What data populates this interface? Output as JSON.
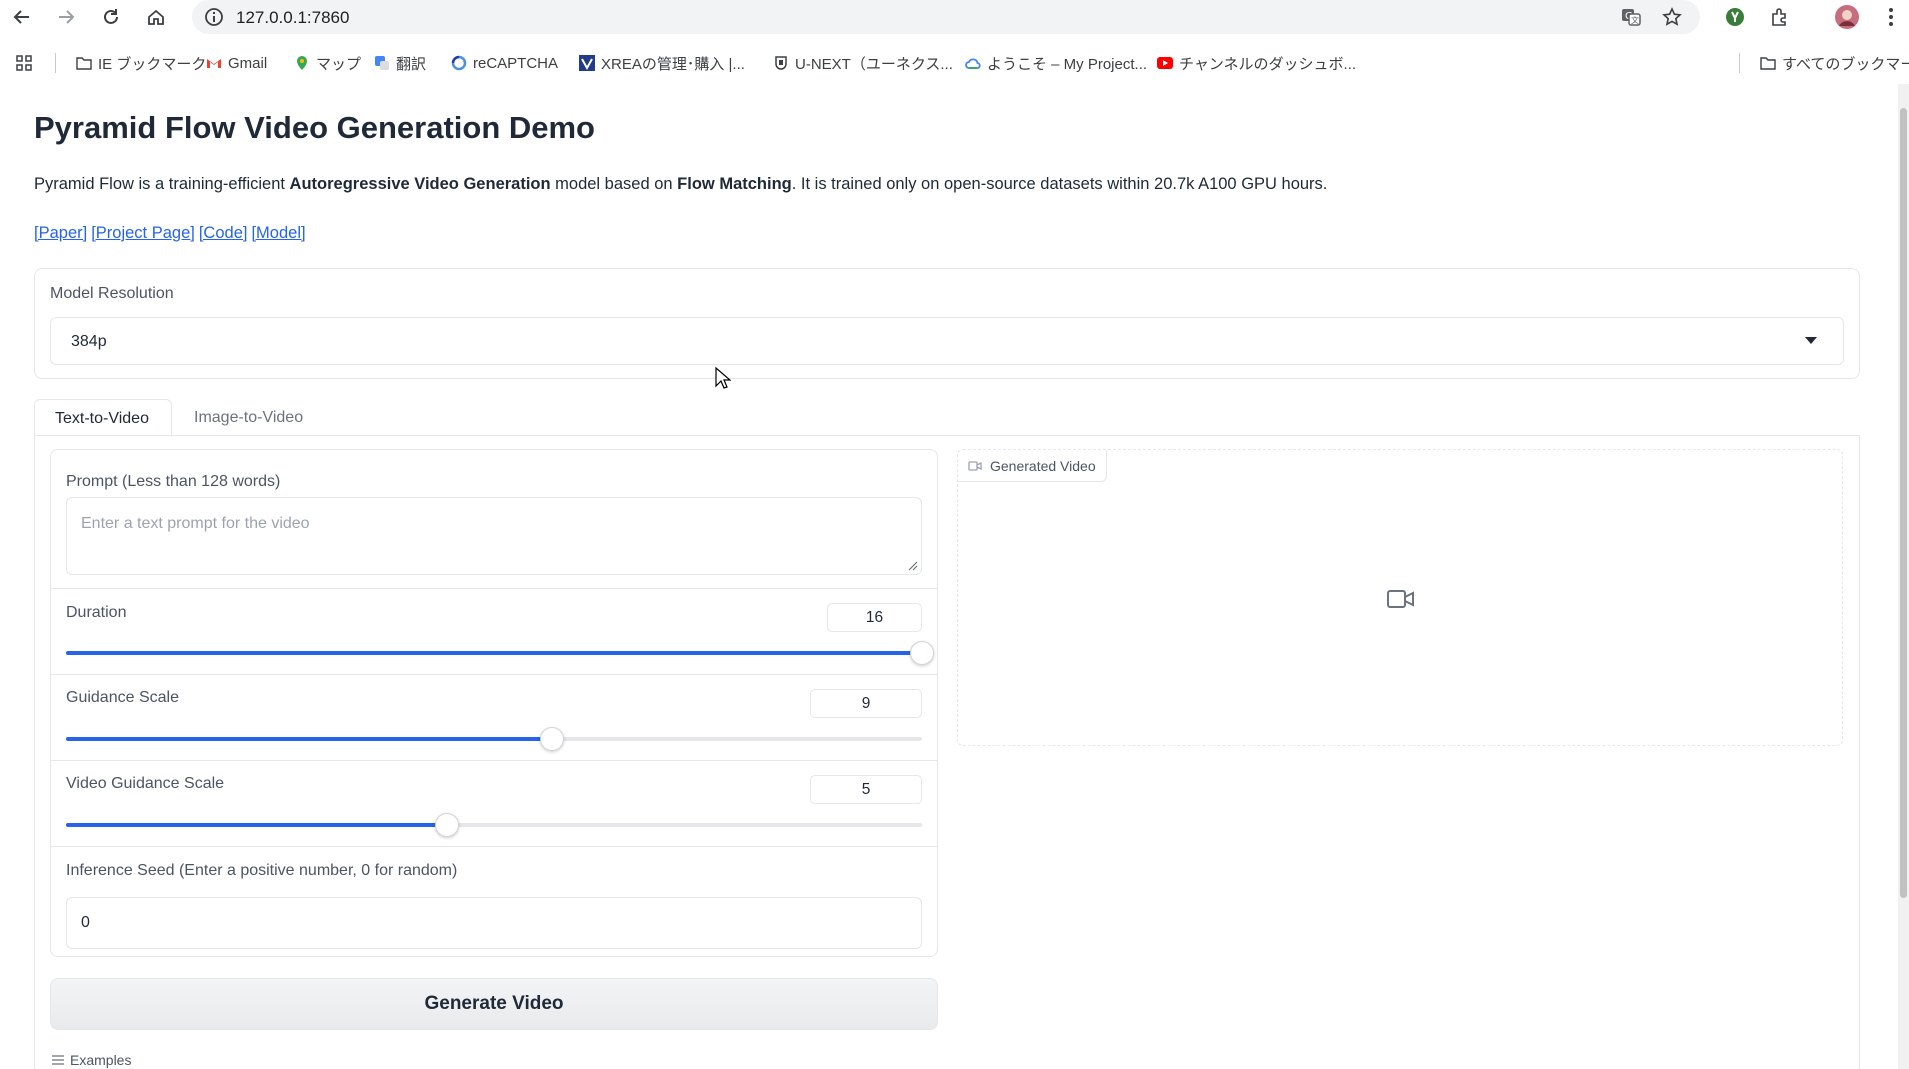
{
  "browser": {
    "url": "127.0.0.1:7860",
    "bookmarks": [
      {
        "label": "IE ブックマーク",
        "icon": "folder-icon"
      },
      {
        "label": "Gmail",
        "icon": "gmail-icon"
      },
      {
        "label": "マップ",
        "icon": "maps-icon"
      },
      {
        "label": "翻訳",
        "icon": "translate-icon"
      },
      {
        "label": "reCAPTCHA",
        "icon": "recaptcha-icon"
      },
      {
        "label": "XREAの管理･購入 |...",
        "icon": "xrea-icon"
      },
      {
        "label": "U-NEXT（ユーネクス...",
        "icon": "unext-icon"
      },
      {
        "label": "ようこそ – My Project...",
        "icon": "cloud-icon"
      },
      {
        "label": "チャンネルのダッシュボ...",
        "icon": "youtube-icon"
      }
    ],
    "all_bookmarks": "すべてのブックマーク"
  },
  "page": {
    "title": "Pyramid Flow Video Generation Demo",
    "description": {
      "part1": "Pyramid Flow is a training-efficient ",
      "bold1": "Autoregressive Video Generation",
      "part2": " model based on ",
      "bold2": "Flow Matching",
      "part3": ". It is trained only on open-source datasets within 20.7k A100 GPU hours."
    },
    "links": [
      "[Paper]",
      "[Project Page]",
      "[Code]",
      "[Model]"
    ]
  },
  "resolution": {
    "label": "Model Resolution",
    "value": "384p"
  },
  "tabs": [
    {
      "label": "Text-to-Video",
      "active": true
    },
    {
      "label": "Image-to-Video",
      "active": false
    }
  ],
  "form": {
    "prompt_label": "Prompt (Less than 128 words)",
    "prompt_placeholder": "Enter a text prompt for the video",
    "duration": {
      "label": "Duration",
      "value": "16",
      "fraction": 1.0
    },
    "guidance": {
      "label": "Guidance Scale",
      "value": "9",
      "fraction": 0.568
    },
    "video_guidance": {
      "label": "Video Guidance Scale",
      "value": "5",
      "fraction": 0.445
    },
    "seed_label": "Inference Seed (Enter a positive number, 0 for random)",
    "seed_value": "0",
    "generate_label": "Generate Video",
    "examples_label": "Examples"
  },
  "output": {
    "label": "Generated Video"
  },
  "colors": {
    "accent": "#2563eb",
    "link": "#2563eb"
  }
}
